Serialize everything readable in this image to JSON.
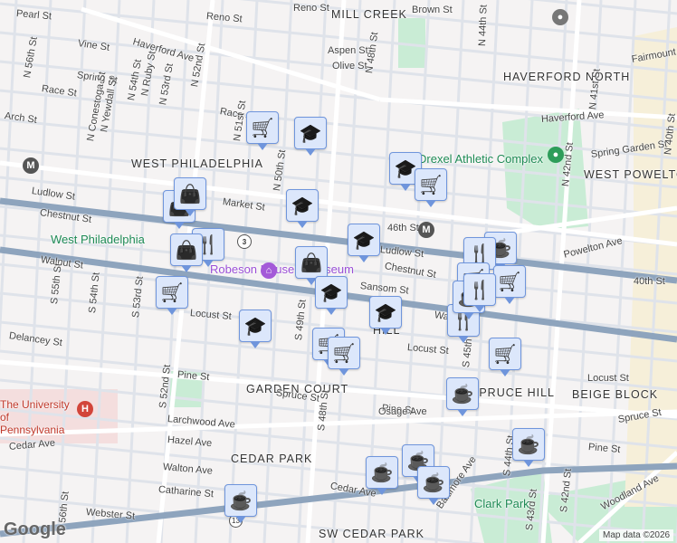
{
  "neighborhoods": [
    "MILL CREEK",
    "HAVERFORD NORTH",
    "WEST PHILADELPHIA",
    "WEST POWELTON",
    "GARDEN COURT",
    "SPRUCE HILL",
    "BEIGE BLOCK",
    "CEDAR PARK",
    "SW CEDAR PARK",
    "HILL"
  ],
  "streets": [
    "Pearl St",
    "Reno St",
    "Reno St",
    "Brown St",
    "Vine St",
    "Haverford Ave",
    "Haverford Ave",
    "Aspen St",
    "Olive St",
    "Spring St",
    "Race St",
    "Arch St",
    "Race St",
    "Ludlow St",
    "Market St",
    "Chestnut St",
    "Chestnut St",
    "Walnut St",
    "Walnut St",
    "Sansom St",
    "Locust St",
    "Locust St",
    "Locust St",
    "Delancey St",
    "Pine St",
    "Pine St",
    "Pine St",
    "Spruce St",
    "Spruce St",
    "Larchwood Ave",
    "Hazel Ave",
    "Cedar Ave",
    "Cedar Ave",
    "Osage Ave",
    "Walton Ave",
    "Catharine St",
    "Webster St",
    "Woodland Ave",
    "Powelton Ave",
    "Spring Garden St",
    "Fairmount",
    "Baltimore Ave",
    "N 52nd St",
    "N 56th St",
    "N 54th St",
    "N Ruby St",
    "N Conestoga St",
    "N Yewdall St",
    "N 53rd St",
    "N 51st St",
    "N 50th St",
    "N 48th St",
    "N 44th St",
    "N 42nd St",
    "N 41st St",
    "N 40th St",
    "S 55th St",
    "S 54th St",
    "S 53rd St",
    "S 52nd St",
    "S 49th St",
    "S 48th St",
    "S 45th St",
    "S 44th St",
    "S 43rd St",
    "S 42nd St",
    "40th St",
    "Ludlow St",
    "S 56th St"
  ],
  "places": {
    "west_philly_station": "West Philadelphia",
    "robeson": "Robeson House & Museum",
    "drexel": "Drexel Athletic Complex",
    "clark_park": "Clark Park",
    "penn": "The University of Pennsylvania",
    "station_46": "46th St",
    "route": "3",
    "route13": "13"
  },
  "markers": [
    "shopping-cart",
    "graduation-cap",
    "graduation-cap",
    "shopping-cart",
    "graduation-cap",
    "shopping-bag",
    "shopping-bag",
    "graduation-cap",
    "restaurant",
    "shopping-bag",
    "coffee",
    "shopping-bag",
    "graduation-cap",
    "shopping-cart",
    "graduation-cap",
    "graduation-cap",
    "restaurant",
    "shopping-cart",
    "shopping-cart",
    "restaurant",
    "coffee",
    "shopping-cart",
    "shopping-cart",
    "restaurant",
    "shopping-cart",
    "coffee",
    "coffee",
    "coffee",
    "coffee",
    "coffee",
    "coffee"
  ],
  "footer": {
    "logo": "Google",
    "attribution": "Map data ©2026"
  },
  "colors": {
    "marker_bg": "#dce7fb",
    "marker_border": "#6f95dc",
    "icon": "#0c3a5b",
    "major_road": "#8ea4bd",
    "park": "#c9ecd5"
  }
}
